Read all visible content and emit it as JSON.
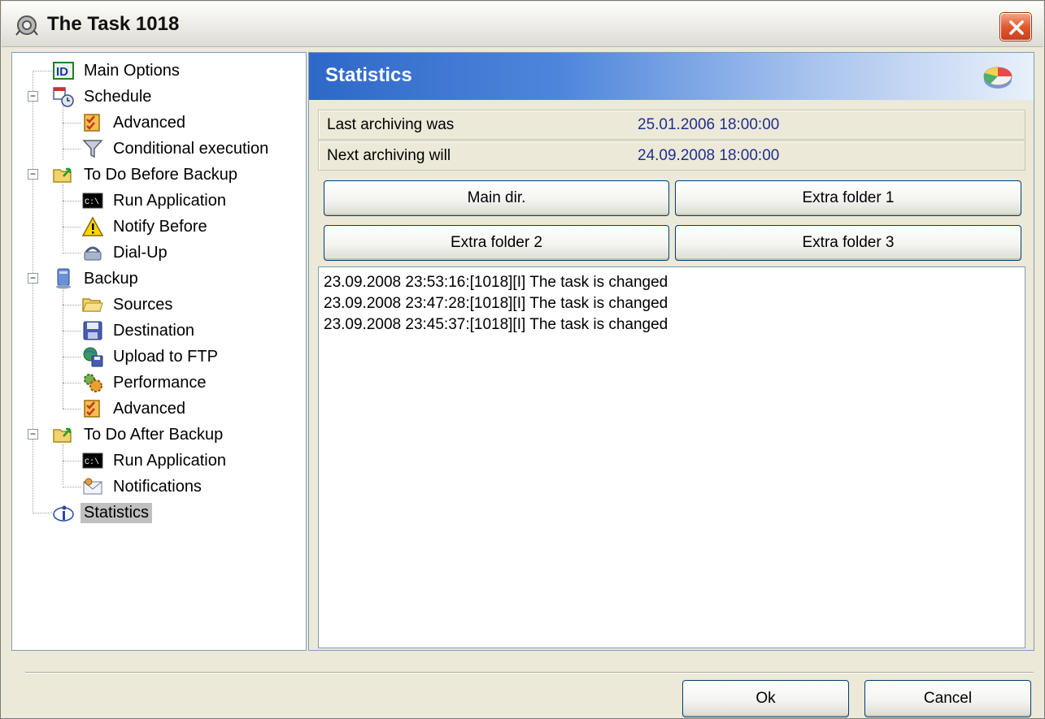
{
  "window": {
    "title": "The Task 1018",
    "title_icon": "task-gear-icon",
    "close_icon": "close-icon"
  },
  "tree": {
    "items": [
      {
        "label": "Main Options",
        "icon": "id-icon",
        "level": 1
      },
      {
        "label": "Schedule",
        "icon": "calendar-clock-icon",
        "level": 0,
        "expanded": true
      },
      {
        "label": "Advanced",
        "icon": "checklist-icon",
        "level": 1
      },
      {
        "label": "Conditional execution",
        "icon": "funnel-icon",
        "level": 1
      },
      {
        "label": "To Do Before Backup",
        "icon": "folder-arrow-icon",
        "level": 0,
        "expanded": true
      },
      {
        "label": "Run Application",
        "icon": "console-icon",
        "level": 1
      },
      {
        "label": "Notify Before",
        "icon": "warning-icon",
        "level": 1
      },
      {
        "label": "Dial-Up",
        "icon": "dialup-icon",
        "level": 1
      },
      {
        "label": "Backup",
        "icon": "computer-icon",
        "level": 0,
        "expanded": true
      },
      {
        "label": "Sources",
        "icon": "folder-icon",
        "level": 1
      },
      {
        "label": "Destination",
        "icon": "floppy-icon",
        "level": 1
      },
      {
        "label": "Upload to FTP",
        "icon": "globe-floppy-icon",
        "level": 1
      },
      {
        "label": "Performance",
        "icon": "gears-icon",
        "level": 1
      },
      {
        "label": "Advanced",
        "icon": "checklist-icon",
        "level": 1
      },
      {
        "label": "To Do After Backup",
        "icon": "folder-arrow-icon",
        "level": 0,
        "expanded": true
      },
      {
        "label": "Run Application",
        "icon": "console-icon",
        "level": 1
      },
      {
        "label": "Notifications",
        "icon": "envelope-icon",
        "level": 1
      },
      {
        "label": "Statistics",
        "icon": "info-icon",
        "level": 0,
        "selected": true
      }
    ]
  },
  "panel": {
    "title": "Statistics",
    "icon": "pie-chart-icon",
    "last_label": "Last archiving was",
    "last_value": "25.01.2006 18:00:00",
    "next_label": "Next archiving will",
    "next_value": "24.09.2008 18:00:00",
    "buttons": [
      "Main dir.",
      "Extra folder 1",
      "Extra folder 2",
      "Extra folder 3"
    ],
    "log": [
      "23.09.2008 23:53:16:[1018][I] The task is changed",
      "23.09.2008 23:47:28:[1018][I] The task is changed",
      "23.09.2008 23:45:37:[1018][I] The task is changed"
    ]
  },
  "footer": {
    "ok_label": "Ok",
    "cancel_label": "Cancel"
  }
}
